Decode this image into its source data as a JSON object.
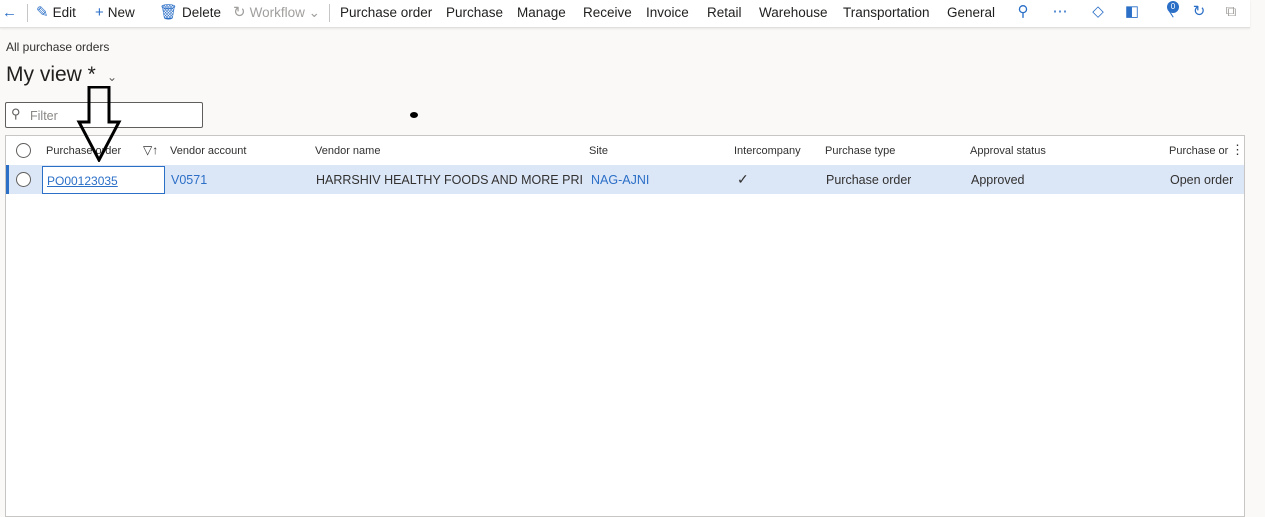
{
  "actionbar": {
    "back_icon": "arrow-left-icon",
    "items": [
      {
        "label": "Edit",
        "icon": "pencil-icon"
      },
      {
        "label": "New",
        "icon": "plus-icon"
      },
      {
        "label": "Delete",
        "icon": "trash-icon"
      },
      {
        "label": "Workflow",
        "icon": "workflow-icon"
      }
    ],
    "menus": [
      "Purchase order",
      "Purchase",
      "Manage",
      "Receive",
      "Invoice",
      "Retail",
      "Warehouse",
      "Transportation",
      "General"
    ],
    "notification_count": "0"
  },
  "breadcrumb": "All purchase orders",
  "view": {
    "title": "My view *"
  },
  "filter": {
    "placeholder": "Filter"
  },
  "grid": {
    "columns": [
      "Purchase order",
      "Vendor account",
      "Vendor name",
      "Site",
      "Intercompany",
      "Purchase type",
      "Approval status",
      "Purchase or"
    ],
    "rows": [
      {
        "purchase_order": "PO00123035",
        "vendor_account": "V0571",
        "vendor_name": "HARRSHIV HEALTHY FOODS AND MORE PRIV...",
        "site": "NAG-AJNI",
        "intercompany": true,
        "purchase_type": "Purchase order",
        "approval_status": "Approved",
        "purchase_order_status": "Open order"
      }
    ]
  },
  "colors": {
    "accent": "#2b6fc7",
    "selected_row": "#dbe6f7"
  }
}
